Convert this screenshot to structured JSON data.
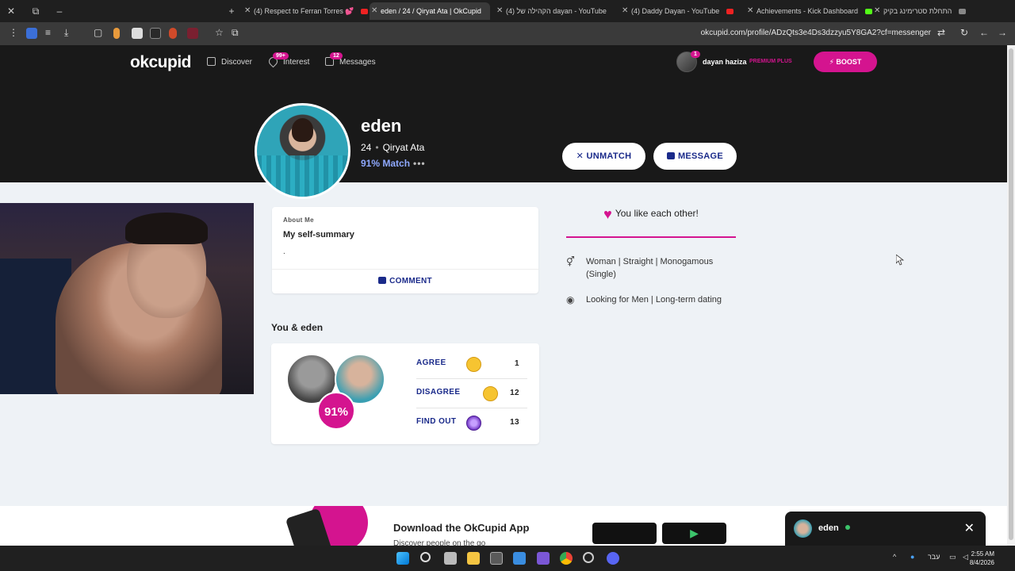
{
  "browser": {
    "tabs": [
      {
        "label": "(4) Respect to Ferran Torres 💕",
        "icon": "youtube-icon",
        "active": false
      },
      {
        "label": "eden / 24 / Qiryat Ata | OkCupid",
        "icon": "okcupid-icon",
        "active": true
      },
      {
        "label": "(4) הקהילה של dayan - YouTube",
        "icon": "youtube-icon",
        "active": false
      },
      {
        "label": "(4) Daddy Dayan - YouTube",
        "icon": "youtube-icon",
        "active": false
      },
      {
        "label": "Achievements - Kick Dashboard",
        "icon": "kick-icon",
        "active": false
      },
      {
        "label": "התחלת סטרימינג בקיק",
        "icon": "kick-icon",
        "active": false
      }
    ],
    "url": "okcupid.com/profile/ADzQts3e4Ds3dzzyu5Y8GA2?cf=messenger"
  },
  "header": {
    "logo": "okcupid",
    "nav": {
      "discover": "Discover",
      "interest": "Interest",
      "interest_badge": "99+",
      "messages": "Messages",
      "messages_badge": "12"
    },
    "user": {
      "name": "dayan haziza",
      "plan": "PREMIUM PLUS",
      "badge": "1"
    },
    "boost": "⚡ BOOST"
  },
  "profile": {
    "name": "eden",
    "age": "24",
    "location": "Qiryat Ata",
    "match": "91% Match",
    "more": "•••",
    "unmatch": "UNMATCH",
    "message": "MESSAGE"
  },
  "about": {
    "label": "About Me",
    "title": "My self-summary",
    "text": ".",
    "comment": "COMMENT"
  },
  "compare": {
    "heading": "You & eden",
    "percent": "91%",
    "rows": [
      {
        "label": "AGREE",
        "count": "1"
      },
      {
        "label": "DISAGREE",
        "count": "12"
      },
      {
        "label": "FIND OUT",
        "count": "13"
      }
    ]
  },
  "details": {
    "mutual": "You like each other!",
    "identity": "Woman | Straight | Monogamous (Single)",
    "looking": "Looking for Men | Long-term dating"
  },
  "banner": {
    "title": "Download the OkCupid App",
    "subtitle": "Discover people on the go"
  },
  "chat": {
    "name": "eden"
  },
  "taskbar": {
    "lang": "עבר",
    "time": "2:55 AM",
    "date": "8/4/2026"
  },
  "colors": {
    "accent": "#d4148f",
    "header_bg": "#191919",
    "link_blue": "#1a2a8a",
    "match_blue": "#8fa9ff"
  }
}
